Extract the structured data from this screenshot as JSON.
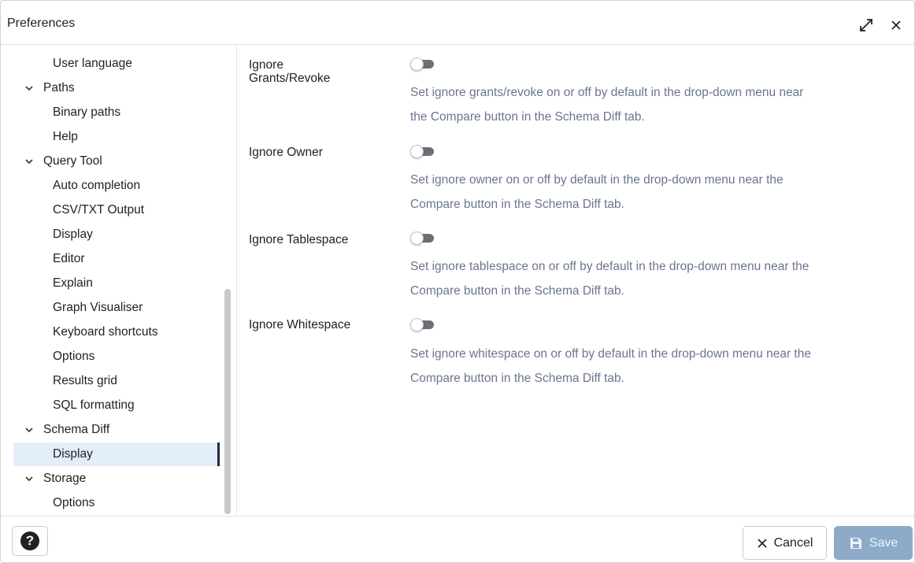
{
  "window": {
    "title": "Preferences"
  },
  "sidebar": {
    "items": [
      {
        "label": "User language",
        "level": "child"
      },
      {
        "label": "Paths",
        "level": "parent",
        "expanded": true
      },
      {
        "label": "Binary paths",
        "level": "child"
      },
      {
        "label": "Help",
        "level": "child"
      },
      {
        "label": "Query Tool",
        "level": "parent",
        "expanded": true
      },
      {
        "label": "Auto completion",
        "level": "child"
      },
      {
        "label": "CSV/TXT Output",
        "level": "child"
      },
      {
        "label": "Display",
        "level": "child"
      },
      {
        "label": "Editor",
        "level": "child"
      },
      {
        "label": "Explain",
        "level": "child"
      },
      {
        "label": "Graph Visualiser",
        "level": "child"
      },
      {
        "label": "Keyboard shortcuts",
        "level": "child"
      },
      {
        "label": "Options",
        "level": "child"
      },
      {
        "label": "Results grid",
        "level": "child"
      },
      {
        "label": "SQL formatting",
        "level": "child"
      },
      {
        "label": "Schema Diff",
        "level": "parent",
        "expanded": true
      },
      {
        "label": "Display",
        "level": "child",
        "selected": true
      },
      {
        "label": "Storage",
        "level": "parent",
        "expanded": true
      },
      {
        "label": "Options",
        "level": "child"
      }
    ]
  },
  "settings": [
    {
      "label_line1": "Ignore",
      "label_line2": "Grants/Revoke",
      "enabled": false,
      "desc_line1": "Set ignore grants/revoke on or off by default in the drop-down menu near",
      "desc_line2": "the Compare button in the Schema Diff tab."
    },
    {
      "label_line1": "Ignore Owner",
      "label_line2": "",
      "enabled": false,
      "desc_line1": "Set ignore owner on or off by default in the drop-down menu near the",
      "desc_line2": "Compare button in the Schema Diff tab."
    },
    {
      "label_line1": "Ignore Tablespace",
      "label_line2": "",
      "enabled": false,
      "desc_line1": "Set ignore tablespace on or off by default in the drop-down menu near the",
      "desc_line2": "Compare button in the Schema Diff tab."
    },
    {
      "label_line1": "Ignore Whitespace",
      "label_line2": "",
      "enabled": false,
      "desc_line1": "Set ignore whitespace on or off by default in the drop-down menu near the",
      "desc_line2": "Compare button in the Schema Diff tab."
    }
  ],
  "footer": {
    "help_icon_glyph": "?",
    "cancel_label": "Cancel",
    "save_label": "Save"
  },
  "icons": {
    "expand": "expand-diagonal-icon",
    "close": "close-icon",
    "chevron": "chevron-down-icon",
    "help": "help-circle-icon",
    "cancel": "close-icon",
    "save": "floppy-disk-icon"
  },
  "colors": {
    "selected_bg": "#e3eefa",
    "description_text": "#6a7590",
    "save_button_bg": "#8daac9",
    "toggle_track_off": "#6b6f77"
  }
}
